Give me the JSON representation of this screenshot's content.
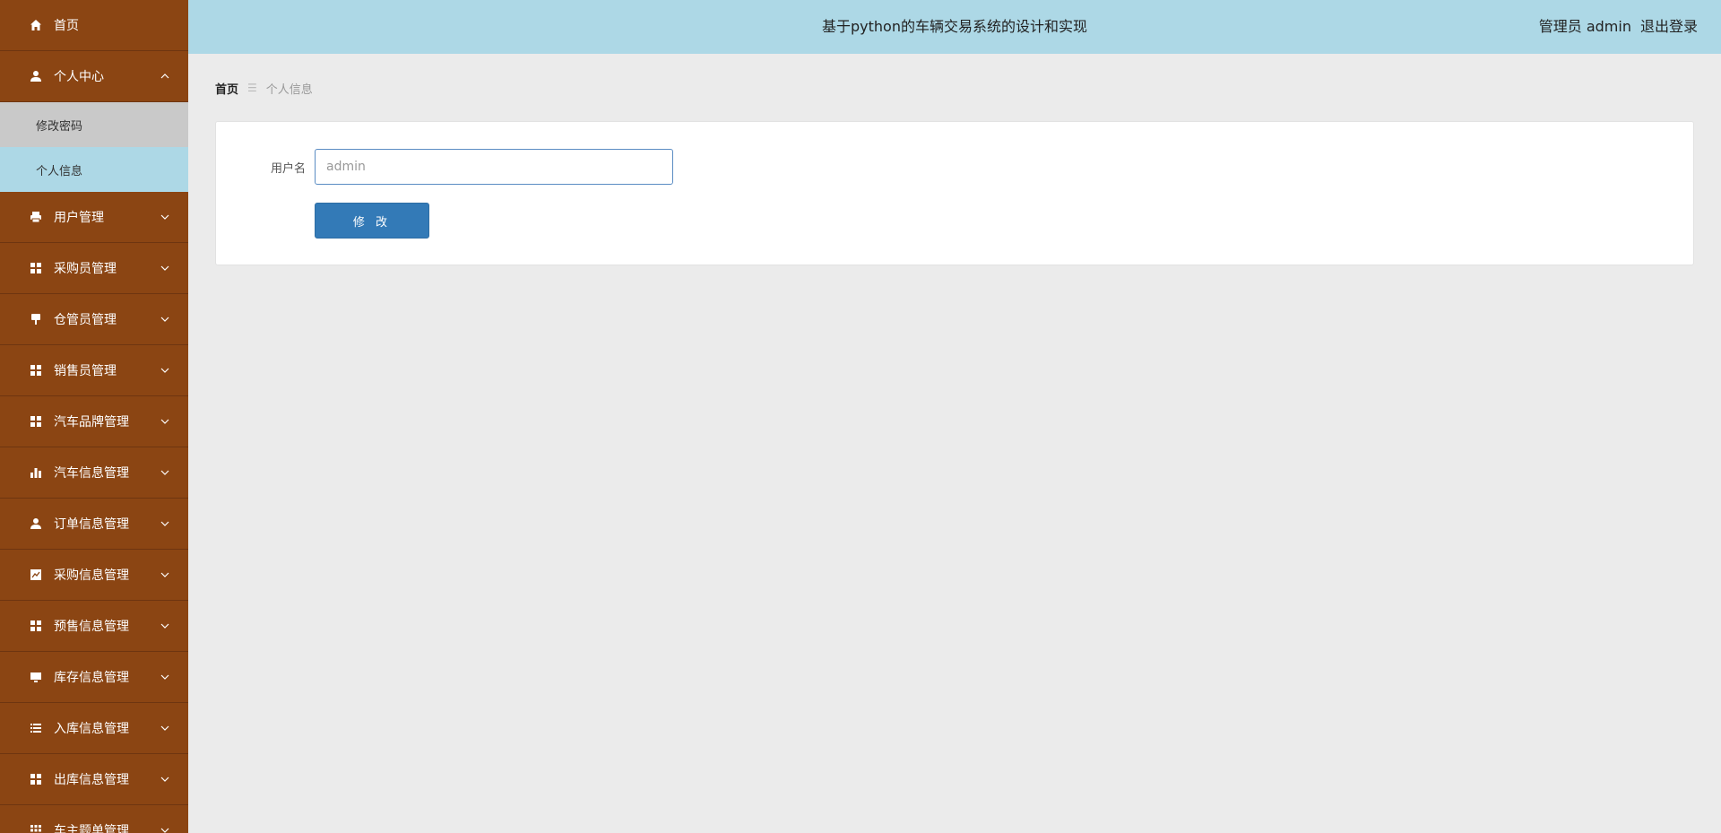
{
  "header": {
    "title": "基于python的车辆交易系统的设计和实现",
    "user_label": "管理员 admin",
    "logout": "退出登录"
  },
  "sidebar": {
    "items": [
      {
        "label": "首页",
        "icon": "home-icon"
      },
      {
        "label": "个人中心",
        "icon": "user-icon",
        "expanded": true,
        "children": [
          {
            "label": "修改密码"
          },
          {
            "label": "个人信息"
          }
        ]
      },
      {
        "label": "用户管理",
        "icon": "printer-icon"
      },
      {
        "label": "采购员管理",
        "icon": "grid-icon"
      },
      {
        "label": "仓管员管理",
        "icon": "brush-icon"
      },
      {
        "label": "销售员管理",
        "icon": "grid-icon"
      },
      {
        "label": "汽车品牌管理",
        "icon": "grid-icon"
      },
      {
        "label": "汽车信息管理",
        "icon": "bar-chart-icon"
      },
      {
        "label": "订单信息管理",
        "icon": "user-icon"
      },
      {
        "label": "采购信息管理",
        "icon": "line-chart-icon"
      },
      {
        "label": "预售信息管理",
        "icon": "grid-icon"
      },
      {
        "label": "库存信息管理",
        "icon": "monitor-icon"
      },
      {
        "label": "入库信息管理",
        "icon": "list-icon"
      },
      {
        "label": "出库信息管理",
        "icon": "grid-icon"
      },
      {
        "label": "车主题单管理",
        "icon": "grid-icon"
      }
    ]
  },
  "breadcrumb": {
    "home": "首页",
    "separator": "☰",
    "current": "个人信息"
  },
  "form": {
    "username_label": "用户名",
    "username_value": "admin",
    "submit_label": "修 改"
  },
  "colors": {
    "sidebar_bg": "#8b4513",
    "header_bg": "#add8e6",
    "active_sub_bg": "#add8e6",
    "hover_sub_bg": "#c9c9c9",
    "primary_button": "#337ab7"
  }
}
